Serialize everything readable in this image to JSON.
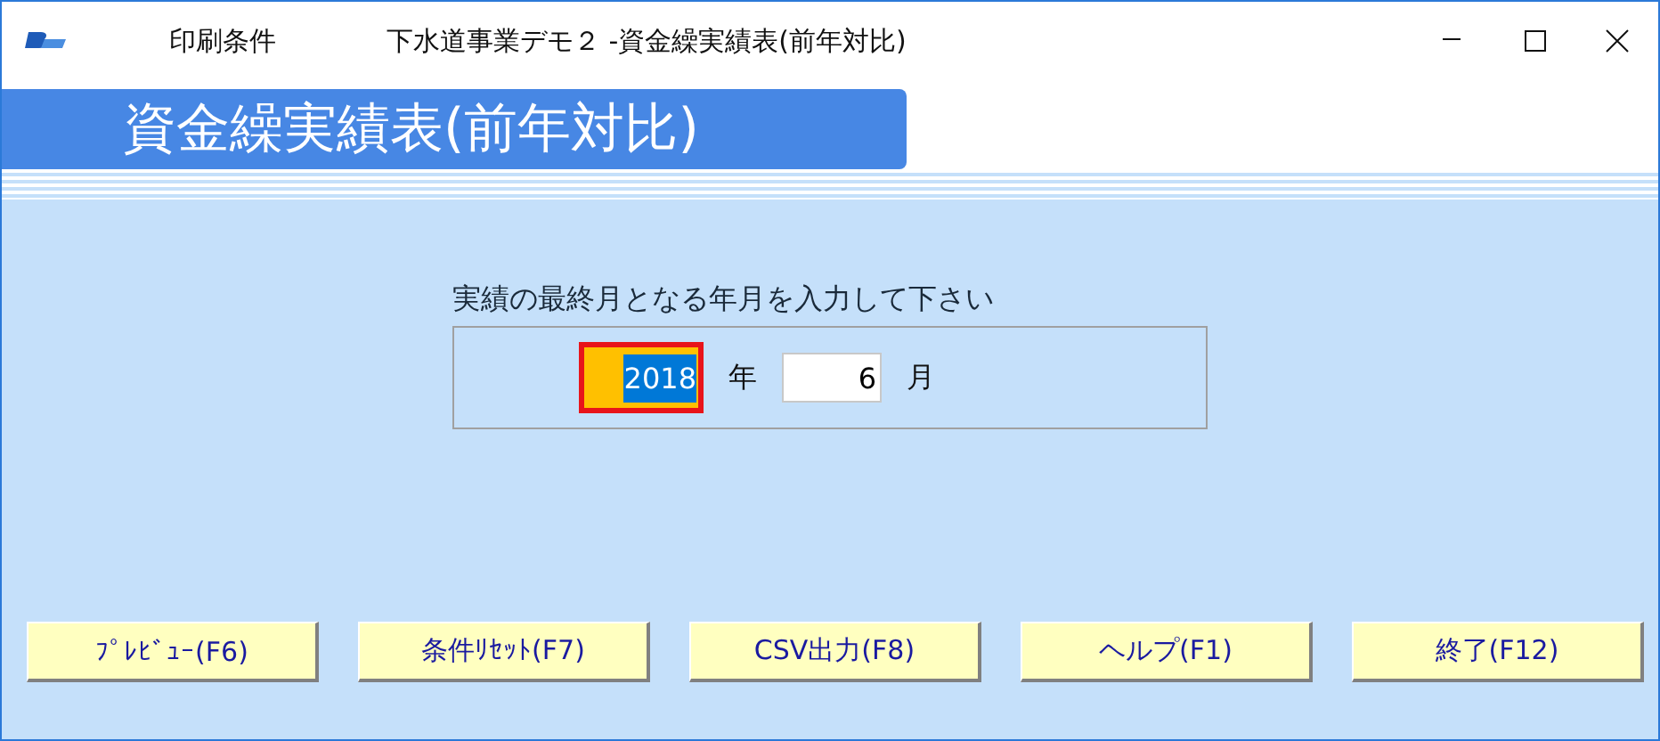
{
  "window": {
    "section": "印刷条件",
    "title": "下水道事業デモ２ -資金繰実績表(前年対比)"
  },
  "banner": {
    "title": "資金繰実績表(前年対比)"
  },
  "prompt": "実績の最終月となる年月を入力して下さい",
  "fields": [
    {
      "value": "2018",
      "unit": "年",
      "focused": true
    },
    {
      "value": "6",
      "unit": "月",
      "focused": false
    }
  ],
  "buttons": [
    "ﾌﾟﾚﾋﾞｭｰ(F6)",
    "条件ﾘｾｯﾄ(F7)",
    "CSV出力(F8)",
    "ヘルプ(F1)",
    "終了(F12)"
  ]
}
